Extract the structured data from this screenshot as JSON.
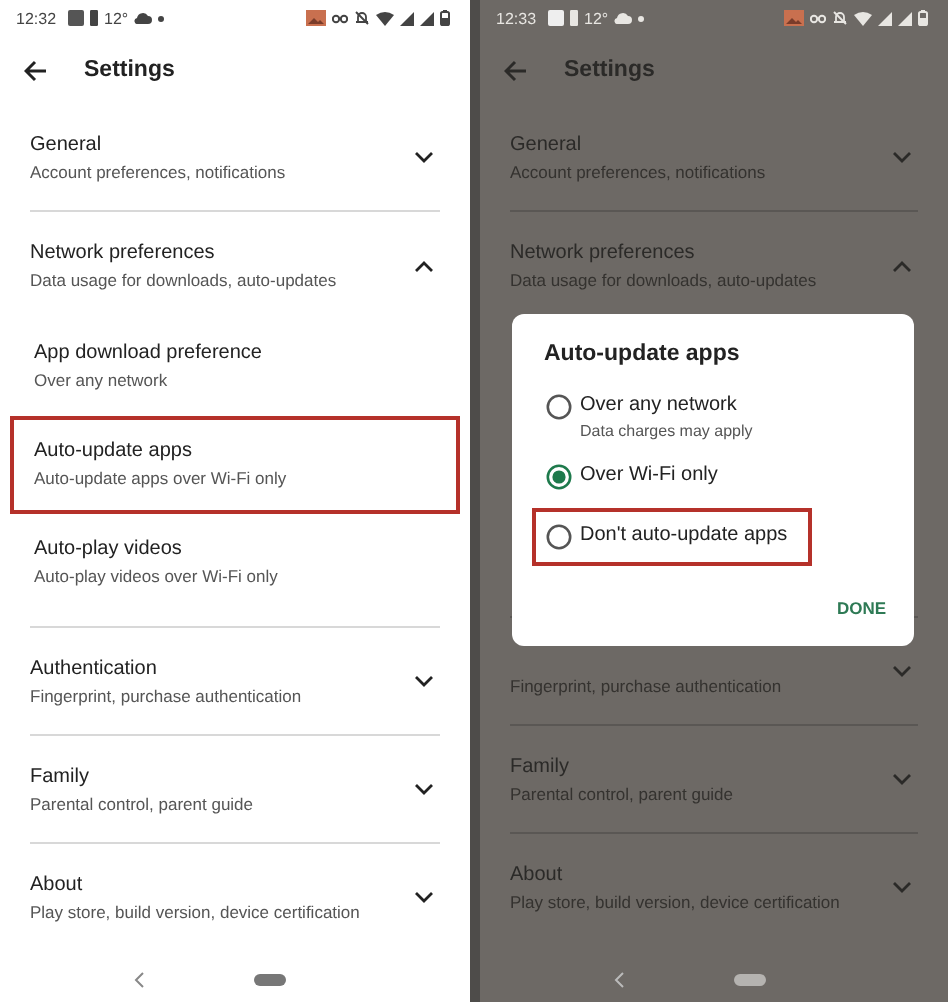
{
  "screens": [
    {
      "dimmed": false,
      "status_bar": {
        "time": "12:32",
        "temperature": "12°"
      },
      "header": {
        "title": "Settings"
      },
      "sections": [
        {
          "title": "General",
          "subtitle": "Account preferences, notifications",
          "expanded": false
        },
        {
          "title": "Network preferences",
          "subtitle": "Data usage for downloads, auto-updates",
          "expanded": true,
          "children": [
            {
              "title": "App download preference",
              "subtitle": "Over any network",
              "highlighted": false
            },
            {
              "title": "Auto-update apps",
              "subtitle": "Auto-update apps over Wi-Fi only",
              "highlighted": true
            },
            {
              "title": "Auto-play videos",
              "subtitle": "Auto-play videos over Wi-Fi only",
              "highlighted": false
            }
          ]
        },
        {
          "title": "Authentication",
          "subtitle": "Fingerprint, purchase authentication",
          "expanded": false
        },
        {
          "title": "Family",
          "subtitle": "Parental control, parent guide",
          "expanded": false
        },
        {
          "title": "About",
          "subtitle": "Play store, build version, device certification",
          "expanded": false
        }
      ]
    },
    {
      "dimmed": true,
      "status_bar": {
        "time": "12:33",
        "temperature": "12°"
      },
      "header": {
        "title": "Settings"
      },
      "sections": [
        {
          "title": "General",
          "subtitle": "Account preferences, notifications",
          "expanded": false
        },
        {
          "title": "Network preferences",
          "subtitle": "Data usage for downloads, auto-updates",
          "expanded": true
        },
        {
          "subtitle": "Fingerprint, purchase authentication",
          "expanded": false
        },
        {
          "title": "Family",
          "subtitle": "Parental control, parent guide",
          "expanded": false
        },
        {
          "title": "About",
          "subtitle": "Play store, build version, device certification",
          "expanded": false
        }
      ],
      "dialog": {
        "title": "Auto-update apps",
        "options": [
          {
            "label": "Over any network",
            "hint": "Data charges may apply",
            "selected": false,
            "highlighted": false
          },
          {
            "label": "Over Wi-Fi only",
            "selected": true,
            "highlighted": false
          },
          {
            "label": "Don't auto-update apps",
            "selected": false,
            "highlighted": true
          }
        ],
        "button": "DONE"
      }
    }
  ]
}
